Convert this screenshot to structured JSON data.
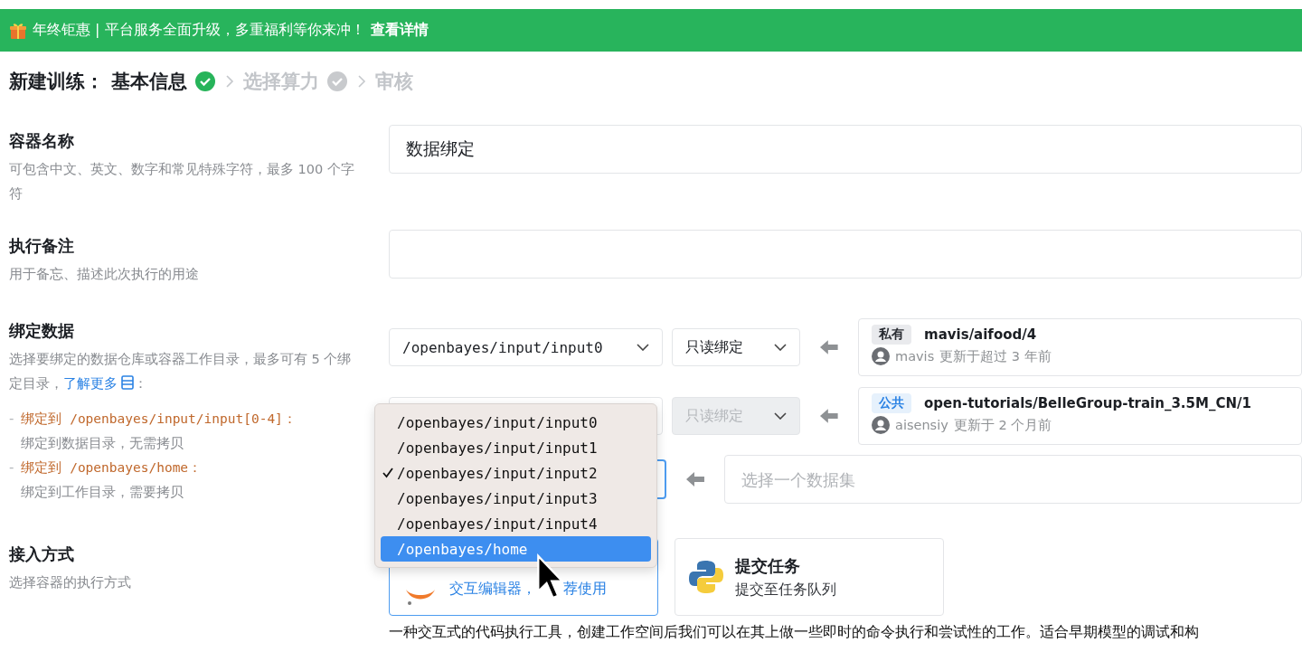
{
  "banner": {
    "text": "年终钜惠 | 平台服务全面升级，多重福利等你来冲！",
    "link": "查看详情"
  },
  "breadcrumb": {
    "prefix": "新建训练：",
    "steps": [
      {
        "label": "基本信息",
        "active": true,
        "check": true
      },
      {
        "label": "选择算力",
        "active": false,
        "check": true
      },
      {
        "label": "审核",
        "active": false,
        "check": false
      }
    ]
  },
  "name_section": {
    "label": "容器名称",
    "hint": "可包含中文、英文、数字和常见特殊字符，最多 100 个字符",
    "value": "数据绑定"
  },
  "note_section": {
    "label": "执行备注",
    "hint": "用于备忘、描述此次执行的用途"
  },
  "bind_section": {
    "label": "绑定数据",
    "hint": "选择要绑定的数据仓库或容器工作目录，最多可有 5 个绑定目录，",
    "link": "了解更多",
    "hint_end": "：",
    "rules": [
      {
        "marker": "-",
        "title": "绑定到 /openbayes/input/input[0-4]：",
        "desc": "绑定到数据目录，无需拷贝"
      },
      {
        "marker": "-",
        "title": "绑定到 /openbayes/home：",
        "desc": "绑定到工作目录，需要拷贝"
      }
    ],
    "bindings": [
      {
        "path": "/openbayes/input/input0",
        "mode": "只读绑定",
        "disabled": false,
        "focused": false,
        "dataset": {
          "tag": "私有",
          "kind": "private",
          "name": "mavis/aifood/4",
          "user": "mavis",
          "updated": "更新于超过 3 年前"
        }
      },
      {
        "mode": "只读绑定",
        "disabled": true,
        "focused": false,
        "dataset": {
          "tag": "公共",
          "kind": "public",
          "name": "open-tutorials/BelleGroup-train_3.5M_CN/1",
          "user": "aisensiy",
          "updated": "更新于 2 个月前"
        }
      },
      {
        "focused": true,
        "placeholder": "选择一个数据集"
      }
    ],
    "dropdown": [
      {
        "label": "/openbayes/input/input0",
        "checked": false,
        "selected": false
      },
      {
        "label": "/openbayes/input/input1",
        "checked": false,
        "selected": false
      },
      {
        "label": "/openbayes/input/input2",
        "checked": true,
        "selected": false
      },
      {
        "label": "/openbayes/input/input3",
        "checked": false,
        "selected": false
      },
      {
        "label": "/openbayes/input/input4",
        "checked": false,
        "selected": false
      },
      {
        "label": "/openbayes/home",
        "checked": false,
        "selected": true
      }
    ]
  },
  "access_section": {
    "label": "接入方式",
    "hint": "选择容器的执行方式",
    "cards": [
      {
        "kind": "notebook",
        "desc": "交互编辑器，",
        "desc_after_cursor": "荐使用",
        "selected": true
      },
      {
        "kind": "python",
        "title": "提交任务",
        "desc": "提交至任务队列",
        "selected": false
      }
    ],
    "description": "一种交互式的代码执行工具，创建工作空间后我们可以在其上做一些即时的命令执行和尝试性的工作。适合早期模型的调试和构"
  }
}
